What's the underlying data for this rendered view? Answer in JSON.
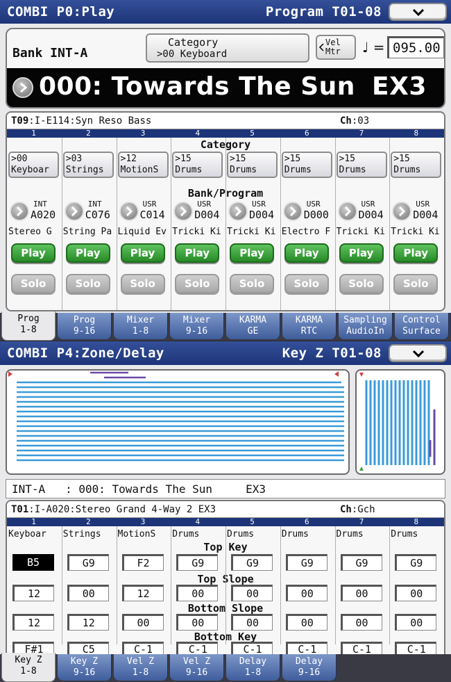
{
  "screen1": {
    "title_left": "COMBI P0:Play",
    "title_right": "Program T01-08",
    "bank_label": "Bank INT-A",
    "category_line1": "Category",
    "category_line2": ">00 Keyboard",
    "vel_mtr_line1": "Vel",
    "vel_mtr_line2": "Mtr",
    "tempo_symbol": "♩ =",
    "tempo_value": "095.00",
    "program_name": "000: Towards The Sun",
    "program_suffix": "EX3",
    "track_id": "T09",
    "track_info": ":I-E114:Syn Reso Bass",
    "ch_label": "Ch",
    "ch_value": ":03",
    "section_category": "Category",
    "section_bank_program": "Bank/Program",
    "timbres": [
      {
        "num": "1",
        "cat_num": ">00",
        "cat_name": "Keyboar",
        "bank": "INT",
        "prog": "A020",
        "name": "Stereo G",
        "play": "Play",
        "solo": "Solo"
      },
      {
        "num": "2",
        "cat_num": ">03",
        "cat_name": "Strings",
        "bank": "INT",
        "prog": "C076",
        "name": "String Pa",
        "play": "Play",
        "solo": "Solo"
      },
      {
        "num": "3",
        "cat_num": ">12",
        "cat_name": "MotionS",
        "bank": "USR",
        "prog": "C014",
        "name": "Liquid Ev",
        "play": "Play",
        "solo": "Solo"
      },
      {
        "num": "4",
        "cat_num": ">15",
        "cat_name": "Drums",
        "bank": "USR",
        "prog": "D004",
        "name": "Tricki Ki",
        "play": "Play",
        "solo": "Solo"
      },
      {
        "num": "5",
        "cat_num": ">15",
        "cat_name": "Drums",
        "bank": "USR",
        "prog": "D004",
        "name": "Tricki Ki",
        "play": "Play",
        "solo": "Solo"
      },
      {
        "num": "6",
        "cat_num": ">15",
        "cat_name": "Drums",
        "bank": "USR",
        "prog": "D000",
        "name": "Electro F",
        "play": "Play",
        "solo": "Solo"
      },
      {
        "num": "7",
        "cat_num": ">15",
        "cat_name": "Drums",
        "bank": "USR",
        "prog": "D004",
        "name": "Tricki Ki",
        "play": "Play",
        "solo": "Solo"
      },
      {
        "num": "8",
        "cat_num": ">15",
        "cat_name": "Drums",
        "bank": "USR",
        "prog": "D004",
        "name": "Tricki Ki",
        "play": "Play",
        "solo": "Solo"
      }
    ],
    "tabs": [
      {
        "l1": "Prog",
        "l2": "1-8"
      },
      {
        "l1": "Prog",
        "l2": "9-16"
      },
      {
        "l1": "Mixer",
        "l2": "1-8"
      },
      {
        "l1": "Mixer",
        "l2": "9-16"
      },
      {
        "l1": "KARMA",
        "l2": "GE"
      },
      {
        "l1": "KARMA",
        "l2": "RTC"
      },
      {
        "l1": "Sampling",
        "l2": "AudioIn"
      },
      {
        "l1": "Control",
        "l2": "Surface"
      }
    ]
  },
  "screen2": {
    "title_left": "COMBI P4:Zone/Delay",
    "title_right": "Key Z T01-08",
    "info_line": "INT-A   : 000: Towards The Sun     EX3",
    "track_id": "T01",
    "track_info": ":I-A020:Stereo Grand 4-Way 2 EX3",
    "ch_label": "Ch",
    "ch_value": ":Gch",
    "section_top_key": "Top Key",
    "section_top_slope": "Top Slope",
    "section_bottom_slope": "Bottom Slope",
    "section_bottom_key": "Bottom Key",
    "timbres": [
      {
        "num": "1",
        "cat": "Keyboar",
        "top_key": "B5",
        "top_slope": "12",
        "bottom_slope": "12",
        "bottom_key": "F#1"
      },
      {
        "num": "2",
        "cat": "Strings",
        "top_key": "G9",
        "top_slope": "00",
        "bottom_slope": "12",
        "bottom_key": "C5"
      },
      {
        "num": "3",
        "cat": "MotionS",
        "top_key": "F2",
        "top_slope": "12",
        "bottom_slope": "00",
        "bottom_key": "C-1"
      },
      {
        "num": "4",
        "cat": "Drums",
        "top_key": "G9",
        "top_slope": "00",
        "bottom_slope": "00",
        "bottom_key": "C-1"
      },
      {
        "num": "5",
        "cat": "Drums",
        "top_key": "G9",
        "top_slope": "00",
        "bottom_slope": "00",
        "bottom_key": "C-1"
      },
      {
        "num": "6",
        "cat": "Drums",
        "top_key": "G9",
        "top_slope": "00",
        "bottom_slope": "00",
        "bottom_key": "C-1"
      },
      {
        "num": "7",
        "cat": "Drums",
        "top_key": "G9",
        "top_slope": "00",
        "bottom_slope": "00",
        "bottom_key": "C-1"
      },
      {
        "num": "8",
        "cat": "Drums",
        "top_key": "G9",
        "top_slope": "00",
        "bottom_slope": "00",
        "bottom_key": "C-1"
      }
    ],
    "tabs": [
      {
        "l1": "Key Z",
        "l2": "1-8"
      },
      {
        "l1": "Key Z",
        "l2": "9-16"
      },
      {
        "l1": "Vel Z",
        "l2": "1-8"
      },
      {
        "l1": "Vel Z",
        "l2": "9-16"
      },
      {
        "l1": "Delay",
        "l2": "1-8"
      },
      {
        "l1": "Delay",
        "l2": "9-16"
      }
    ]
  },
  "colors": {
    "title_bar": "#1d3478",
    "play_green": "#2e9a2e",
    "zone_blue": "#3a9bd8",
    "zone_purple": "#6a4aa8",
    "tab_blue": "#4f6daa"
  }
}
